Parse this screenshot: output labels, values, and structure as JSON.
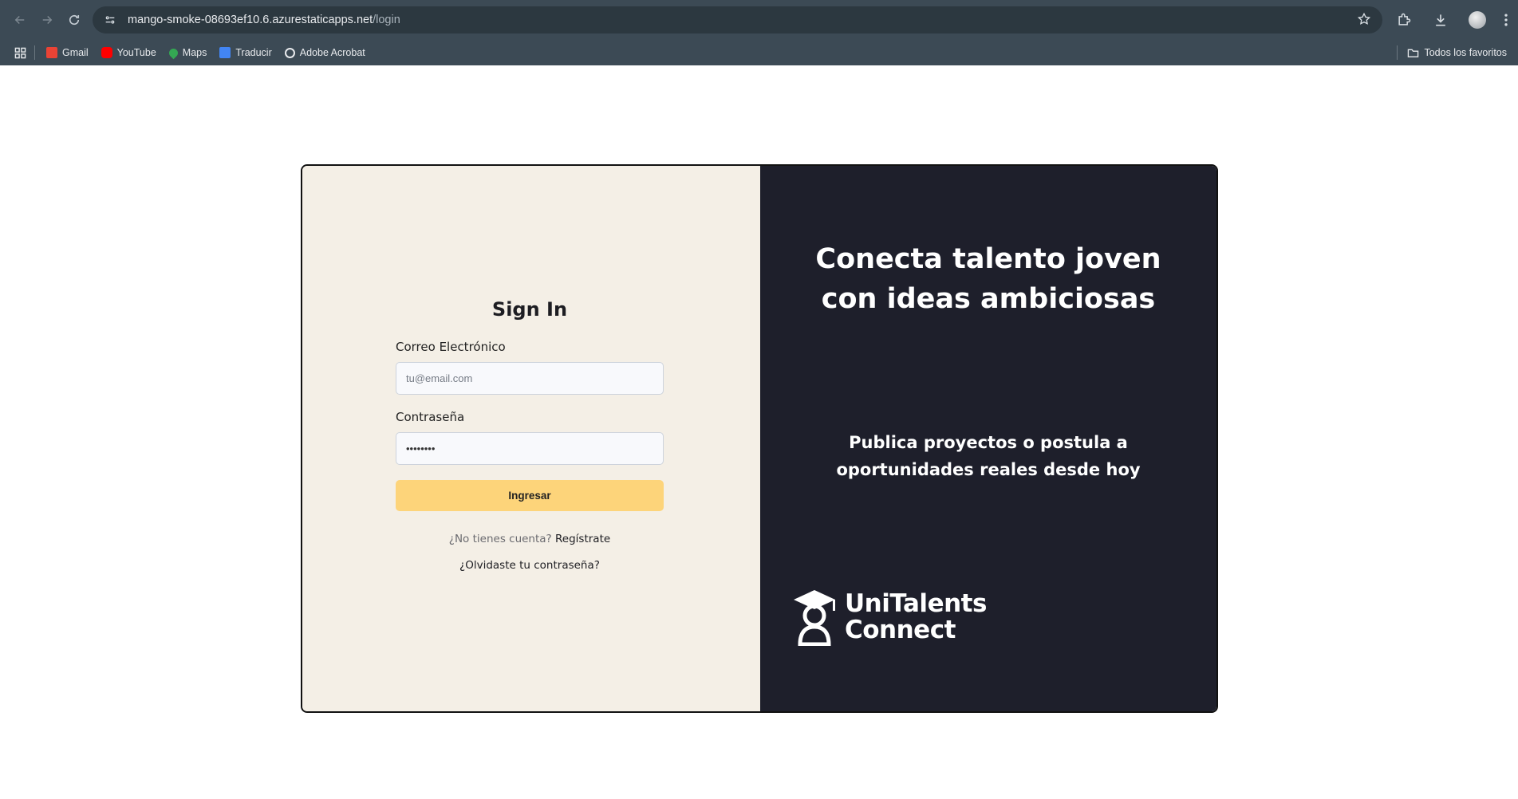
{
  "browser": {
    "url_host": "mango-smoke-08693ef10.6.azurestaticapps.net",
    "url_path": "/login",
    "bookmarks": [
      {
        "label": "Gmail",
        "color": "#ea4335"
      },
      {
        "label": "YouTube",
        "color": "#ff0000"
      },
      {
        "label": "Maps",
        "color": "#34a853"
      },
      {
        "label": "Traducir",
        "color": "#4285f4"
      },
      {
        "label": "Adobe Acrobat",
        "color": "#e8eaed"
      }
    ],
    "all_bookmarks_label": "Todos los favoritos"
  },
  "login": {
    "title": "Sign In",
    "email_label": "Correo Electrónico",
    "email_placeholder": "tu@email.com",
    "password_label": "Contraseña",
    "password_value": "••••••••",
    "submit_label": "Ingresar",
    "no_account_text": "¿No tienes cuenta?",
    "register_link": "Regístrate",
    "forgot_link": "¿Olvidaste tu contraseña?"
  },
  "hero": {
    "title": "Conecta talento joven con ideas ambiciosas",
    "subtitle": "Publica proyectos o postula a oportunidades reales desde hoy",
    "brand_line1": "UniTalents",
    "brand_line2": "Connect"
  },
  "colors": {
    "left_panel": "#f4efe6",
    "right_panel": "#1e1f2b",
    "button": "#fdd47a"
  }
}
